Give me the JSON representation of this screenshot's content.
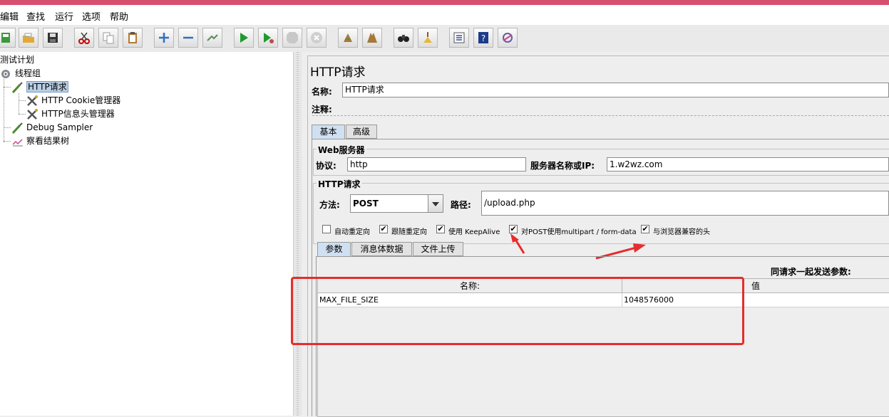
{
  "menu": [
    "编辑",
    "查找",
    "运行",
    "选项",
    "帮助"
  ],
  "toolbar": [
    "new-icon",
    "open-icon",
    "save-icon",
    "cut-icon",
    "copy-icon",
    "paste-icon",
    "expand-icon",
    "collapse-icon",
    "toggle-icon",
    "start-icon",
    "start-no-pause-icon",
    "stop-icon",
    "shutdown-icon",
    "clear-icon",
    "clear-all-icon",
    "search-icon",
    "reset-search-icon",
    "function-helper-icon",
    "help-icon",
    "remote-icon"
  ],
  "tree": {
    "root": "测试计划",
    "thread_group": "线程组",
    "http_request": "HTTP请求",
    "cookie_manager": "HTTP Cookie管理器",
    "header_manager": "HTTP信息头管理器",
    "debug_sampler": "Debug Sampler",
    "result_tree": "察看结果树"
  },
  "panel": {
    "title": "HTTP请求",
    "name_label": "名称:",
    "name_value": "HTTP请求",
    "comment_label": "注释:",
    "tabs": [
      "基本",
      "高级"
    ],
    "web_server": {
      "group": "Web服务器",
      "protocol_label": "协议:",
      "protocol_value": "http",
      "server_label": "服务器名称或IP:",
      "server_value": "1.w2wz.com"
    },
    "http_request": {
      "group": "HTTP请求",
      "method_label": "方法:",
      "method_value": "POST",
      "path_label": "路径:",
      "path_value": "/upload.php"
    },
    "checkboxes": [
      {
        "label": "自动重定向",
        "checked": false
      },
      {
        "label": "跟随重定向",
        "checked": true
      },
      {
        "label": "使用 KeepAlive",
        "checked": true
      },
      {
        "label": "对POST使用multipart / form-data",
        "checked": true
      },
      {
        "label": "与浏览器兼容的头",
        "checked": true
      }
    ],
    "sub_tabs": [
      "参数",
      "消息体数据",
      "文件上传"
    ],
    "params_header": "同请求一起发送参数:",
    "table": {
      "columns": [
        "名称:",
        "值"
      ],
      "rows": [
        [
          "MAX_FILE_SIZE",
          "1048576000"
        ]
      ]
    }
  },
  "colors": {
    "title_bar": "#d6506e",
    "annotation": "#e52d2d",
    "selection": "#b8cfe5"
  }
}
